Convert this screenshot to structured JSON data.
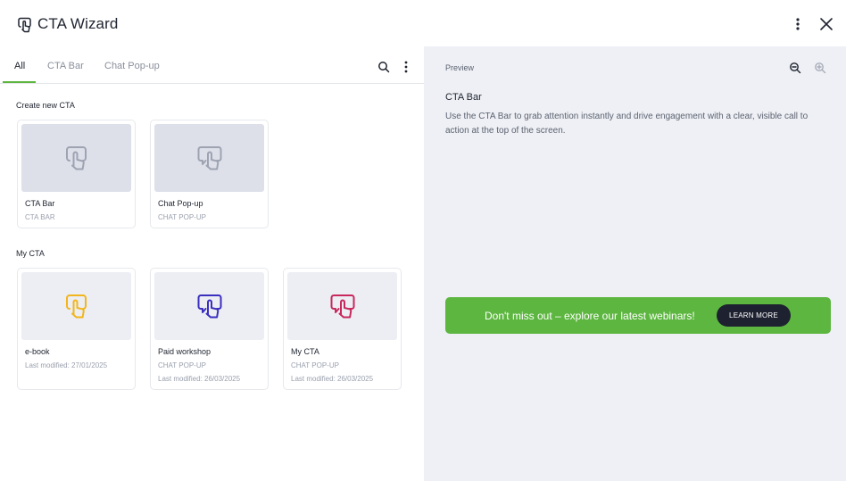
{
  "header": {
    "title": "CTA Wizard",
    "logo_icon": "hand-pointer-icon",
    "more_icon": "more-vertical-icon",
    "close_icon": "close-icon"
  },
  "tabs": [
    {
      "label": "All",
      "active": true
    },
    {
      "label": "CTA Bar",
      "active": false
    },
    {
      "label": "Chat Pop-up",
      "active": false
    }
  ],
  "toolbar": {
    "search_icon": "search-icon",
    "more_icon": "more-vertical-icon"
  },
  "create_section": {
    "title": "Create new CTA",
    "cards": [
      {
        "name": "CTA Bar",
        "sub1": "CTA BAR",
        "sub2": "",
        "icon": "hand-pointer-icon",
        "icon_color": "#9ea3b2"
      },
      {
        "name": "Chat Pop-up",
        "sub1": "CHAT POP-UP",
        "sub2": "",
        "icon": "chat-pointer-icon",
        "icon_color": "#9ea3b2"
      }
    ]
  },
  "my_section": {
    "title": "My CTA",
    "cards": [
      {
        "name": "e-book",
        "sub1": "Last modified: 27/01/2025",
        "sub2": "",
        "icon": "hand-pointer-icon",
        "icon_color": "#f2b51c"
      },
      {
        "name": "Paid workshop",
        "sub1": "CHAT POP-UP",
        "sub2": "Last modified: 26/03/2025",
        "icon": "chat-pointer-icon",
        "icon_color": "#3b2fbf"
      },
      {
        "name": "My CTA",
        "sub1": "CHAT POP-UP",
        "sub2": "Last modified: 26/03/2025",
        "icon": "chat-pointer-icon",
        "icon_color": "#c8285c"
      }
    ]
  },
  "preview": {
    "label": "Preview",
    "zoom_out_icon": "zoom-out-icon",
    "zoom_in_icon": "zoom-in-icon",
    "title": "CTA Bar",
    "description": "Use the CTA Bar to grab attention instantly and drive engagement with a clear, visible call to action at the top of the screen.",
    "cta_text": "Don't miss out – explore our latest webinars!",
    "cta_button": "LEARN MORE",
    "cta_color": "#5cb63f"
  }
}
